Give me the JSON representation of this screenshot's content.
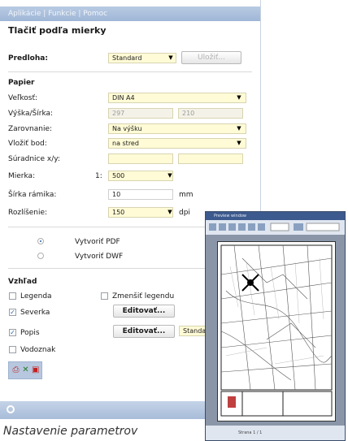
{
  "menu": {
    "items": [
      "Aplikácie",
      "Funkcie",
      "Pomoc"
    ],
    "sep": " | "
  },
  "title": "Tlačiť podľa mierky",
  "predloha": {
    "label": "Predloha:",
    "value": "Standard",
    "button": "Uložiť..."
  },
  "papier": {
    "heading": "Papier",
    "velkost": {
      "label": "Veľkosť:",
      "value": "DIN A4"
    },
    "vyska": {
      "label": "Výška/Šírka:",
      "value1": "297",
      "value2": "210"
    },
    "zarovnanie": {
      "label": "Zarovnanie:",
      "value": "Na výšku"
    },
    "vlozit_bod": {
      "label": "Vložiť bod:",
      "value": "na stred"
    },
    "suradnice": {
      "label": "Súradnice x/y:",
      "value1": "",
      "value2": ""
    },
    "mierka": {
      "label": "Mierka:",
      "prefix": "1:",
      "value": "500"
    },
    "sirka_ramika": {
      "label": "Šírka rámika:",
      "value": "10",
      "unit": "mm"
    },
    "rozlisenie": {
      "label": "Rozlíšenie:",
      "value": "150",
      "unit": "dpi"
    }
  },
  "output": {
    "pdf": "Vytvoriť PDF",
    "dwf": "Vytvoriť DWF"
  },
  "vzhlad": {
    "heading": "Vzhľad",
    "legenda": "Legenda",
    "zmensit": "Zmenšiť legendu",
    "severka": "Severka",
    "popis": "Popis",
    "vodoznak": "Vodoznak",
    "edit1": "Editovať...",
    "edit2": "Editovať...",
    "standa": "Standa"
  },
  "preview": {
    "title": "Preview window",
    "foot": "Strana 1 / 1"
  },
  "caption": "Nastavenie parametrov"
}
